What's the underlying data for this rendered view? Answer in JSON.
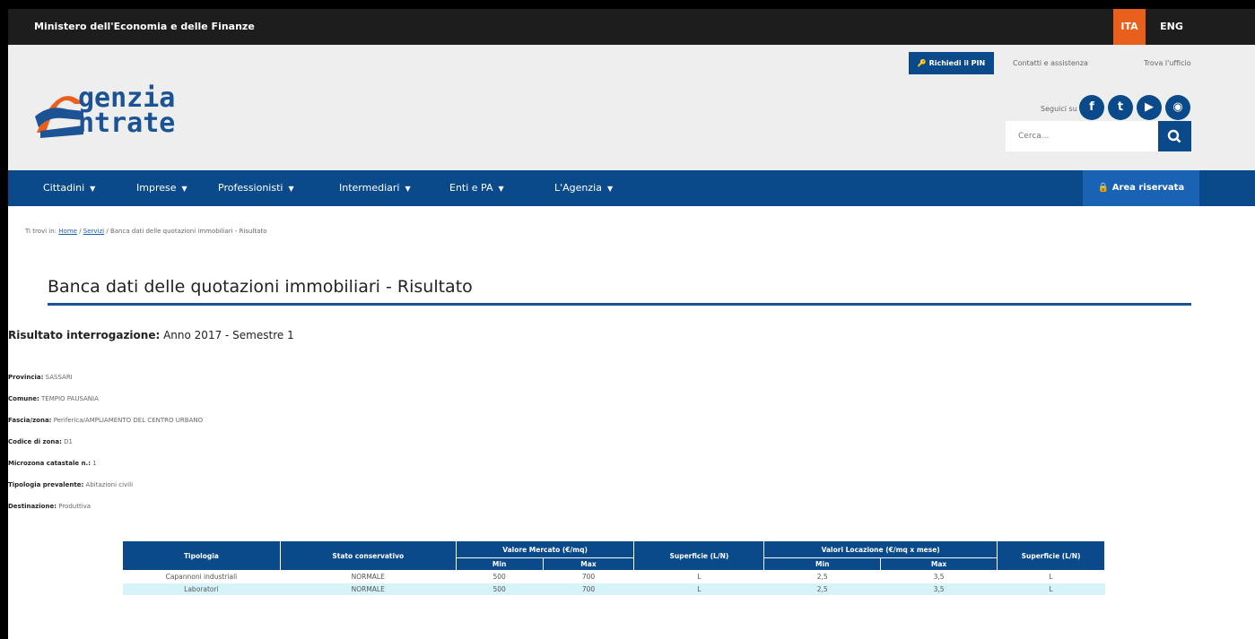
{
  "topbar": {
    "ministry": "Ministero dell'Economia e delle Finanze",
    "lang_ita": "ITA",
    "lang_eng": "ENG"
  },
  "header": {
    "logo": {
      "line1": "genzia",
      "line2": "ntrate"
    },
    "pin_button": "Richiedi il PIN",
    "contatti": "Contatti e assistenza",
    "trova": "Trova l'ufficio",
    "seguici": "Seguici su",
    "social": [
      {
        "icon": "facebook-icon",
        "glyph": "f"
      },
      {
        "icon": "twitter-icon",
        "glyph": "t"
      },
      {
        "icon": "youtube-icon",
        "glyph": "▶"
      },
      {
        "icon": "rss-icon",
        "glyph": "◉"
      }
    ],
    "search_placeholder": "Cerca..."
  },
  "nav": {
    "items": [
      "Cittadini",
      "Imprese",
      "Professionisti",
      "Intermediari",
      "Enti e PA",
      "L'Agenzia"
    ],
    "area_riservata": "Area riservata"
  },
  "breadcrumb": {
    "prefix": "Ti trovi in:",
    "home": "Home",
    "sep": "/",
    "servizi": "Servizi",
    "current": "Banca dati delle quotazioni immobiliari - Risultato"
  },
  "page_title": "Banca dati delle quotazioni immobiliari - Risultato",
  "result": {
    "label": "Risultato interrogazione:",
    "value": "Anno 2017 - Semestre 1"
  },
  "details": [
    {
      "label": "Provincia:",
      "value": "SASSARI"
    },
    {
      "label": "Comune:",
      "value": "TEMPIO PAUSANIA"
    },
    {
      "label": "Fascia/zona:",
      "value": "Periferica/AMPLIAMENTO DEL CENTRO URBANO"
    },
    {
      "label": "Codice di zona:",
      "value": "D1"
    },
    {
      "label": "Microzona catastale n.:",
      "value": "1"
    },
    {
      "label": "Tipologia prevalente:",
      "value": "Abitazioni civili"
    },
    {
      "label": "Destinazione:",
      "value": "Produttiva"
    }
  ],
  "table": {
    "headers": {
      "tipologia": "Tipologia",
      "stato": "Stato conservativo",
      "valore_mercato": "Valore Mercato (€/mq)",
      "superficie1": "Superficie (L/N)",
      "valori_locazione": "Valori Locazione (€/mq x mese)",
      "superficie2": "Superficie (L/N)",
      "min": "Min",
      "max": "Max"
    },
    "rows": [
      [
        "Capannoni industriali",
        "NORMALE",
        "500",
        "700",
        "L",
        "2,5",
        "3,5",
        "L"
      ],
      [
        "Laboratori",
        "NORMALE",
        "500",
        "700",
        "L",
        "2,5",
        "3,5",
        "L"
      ]
    ]
  }
}
